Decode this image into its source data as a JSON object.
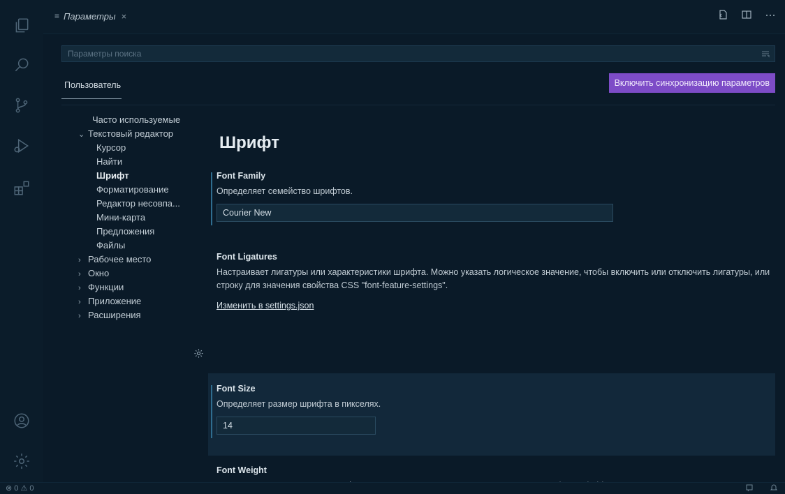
{
  "tab": {
    "title": "Параметры",
    "lines_icon": "≡",
    "close": "×"
  },
  "search": {
    "placeholder": "Параметры поиска"
  },
  "scope": {
    "user_tab": "Пользователь"
  },
  "sync_button": "Включить синхронизацию параметров",
  "toc": {
    "frequent": "Часто используемые",
    "text_editor": "Текстовый редактор",
    "cursor": "Курсор",
    "find": "Найти",
    "font": "Шрифт",
    "formatting": "Форматирование",
    "diff_editor": "Редактор несовпа...",
    "minimap": "Мини-карта",
    "suggestions": "Предложения",
    "files": "Файлы",
    "workbench": "Рабочее место",
    "window": "Окно",
    "features": "Функции",
    "application": "Приложение",
    "extensions": "Расширения"
  },
  "section_title": "Шрифт",
  "settings": {
    "font_family": {
      "title": "Font Family",
      "description": "Определяет семейство шрифтов.",
      "value": "Courier New"
    },
    "font_ligatures": {
      "title": "Font Ligatures",
      "description": "Настраивает лигатуры или характеристики шрифта. Можно указать логическое значение, чтобы включить или отключить лигатуры, или строку для значения свойства CSS \"font-feature-settings\".",
      "link": "Изменить в settings.json"
    },
    "font_size": {
      "title": "Font Size",
      "description": "Определяет размер шрифта в пикселях.",
      "value": "14"
    },
    "font_weight": {
      "title": "Font Weight",
      "description": "Управляет насыщенностью шрифта. Допустимые значения: ключевые слова \"normal\" или \"bold\", а также числа в диапазоне от 1 до 1000."
    }
  },
  "status": {
    "problems": "⊗ 0 ⚠ 0"
  },
  "colors": {
    "sync_button": "#7d4cc7",
    "background": "#0a1a28",
    "modified_bar": "#2f6d8f"
  }
}
